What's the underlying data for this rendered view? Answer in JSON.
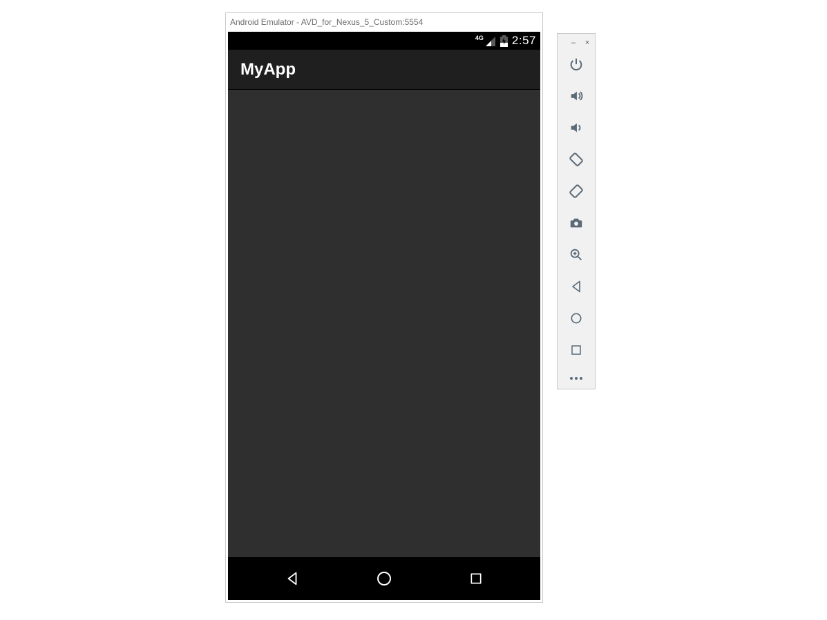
{
  "window": {
    "title": "Android Emulator - AVD_for_Nexus_5_Custom:5554"
  },
  "status_bar": {
    "network_label": "4G",
    "clock": "2:57"
  },
  "app": {
    "title": "MyApp"
  },
  "nav_bar": {
    "back_label": "Back",
    "home_label": "Home",
    "recents_label": "Recents"
  },
  "toolbar": {
    "minimize_label": "–",
    "close_label": "×",
    "buttons": [
      {
        "name": "Power"
      },
      {
        "name": "Volume Up"
      },
      {
        "name": "Volume Down"
      },
      {
        "name": "Rotate Left"
      },
      {
        "name": "Rotate Right"
      },
      {
        "name": "Take Screenshot"
      },
      {
        "name": "Zoom"
      },
      {
        "name": "Back"
      },
      {
        "name": "Home"
      },
      {
        "name": "Overview"
      }
    ],
    "more_label": "More"
  },
  "colors": {
    "device_bg": "#000000",
    "content_bg": "#2f2f2f",
    "appbar_bg": "#1f1f1f",
    "toolbar_bg": "#f1f1f1",
    "toolbar_icon": "#5a6a77"
  }
}
